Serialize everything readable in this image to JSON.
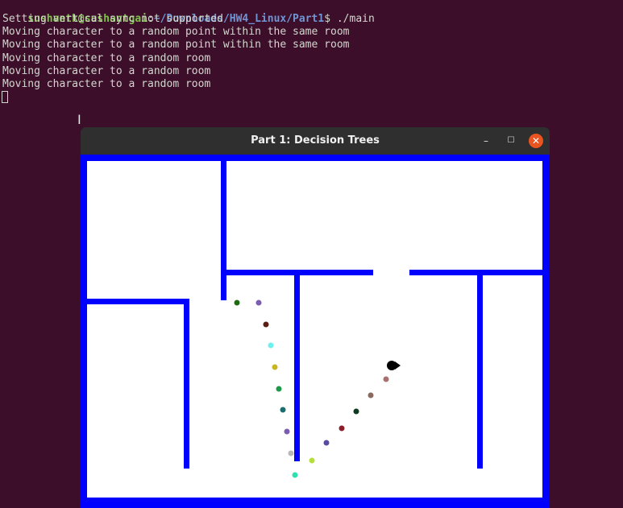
{
  "terminal": {
    "prompt_user": "sushantk@sushantgai",
    "prompt_sep": ":",
    "prompt_path": "~/Downloads/HW4_Linux/Part1",
    "prompt_end": "$ ",
    "command": "./main",
    "lines": [
      "Setting vertical sync not supported",
      "Moving character to a random point within the same room",
      "Moving character to a random point within the same room",
      "Moving character to a random room",
      "Moving character to a random room",
      "Moving character to a random room"
    ]
  },
  "window": {
    "title": "Part 1: Decision Trees",
    "minimize_glyph": "–",
    "maximize_glyph": "☐",
    "close_glyph": "✕"
  },
  "colors": {
    "terminal_bg": "#3c0e29",
    "wall": "#0000ff",
    "floor": "#ffffff",
    "character": "#000000"
  },
  "scene": {
    "breadcrumb_colors": [
      "#1f6b12",
      "#7a5cb0",
      "#5a1e14",
      "#6ef0f0",
      "#c8b424",
      "#1c9a4a",
      "#1a6e6e",
      "#7a5cb0",
      "#b8b8b8",
      "#2ee0b0",
      "#b4e03c",
      "#5a4aa0",
      "#8a1e2a",
      "#0e3a22",
      "#8a6a5e",
      "#a87070"
    ]
  }
}
